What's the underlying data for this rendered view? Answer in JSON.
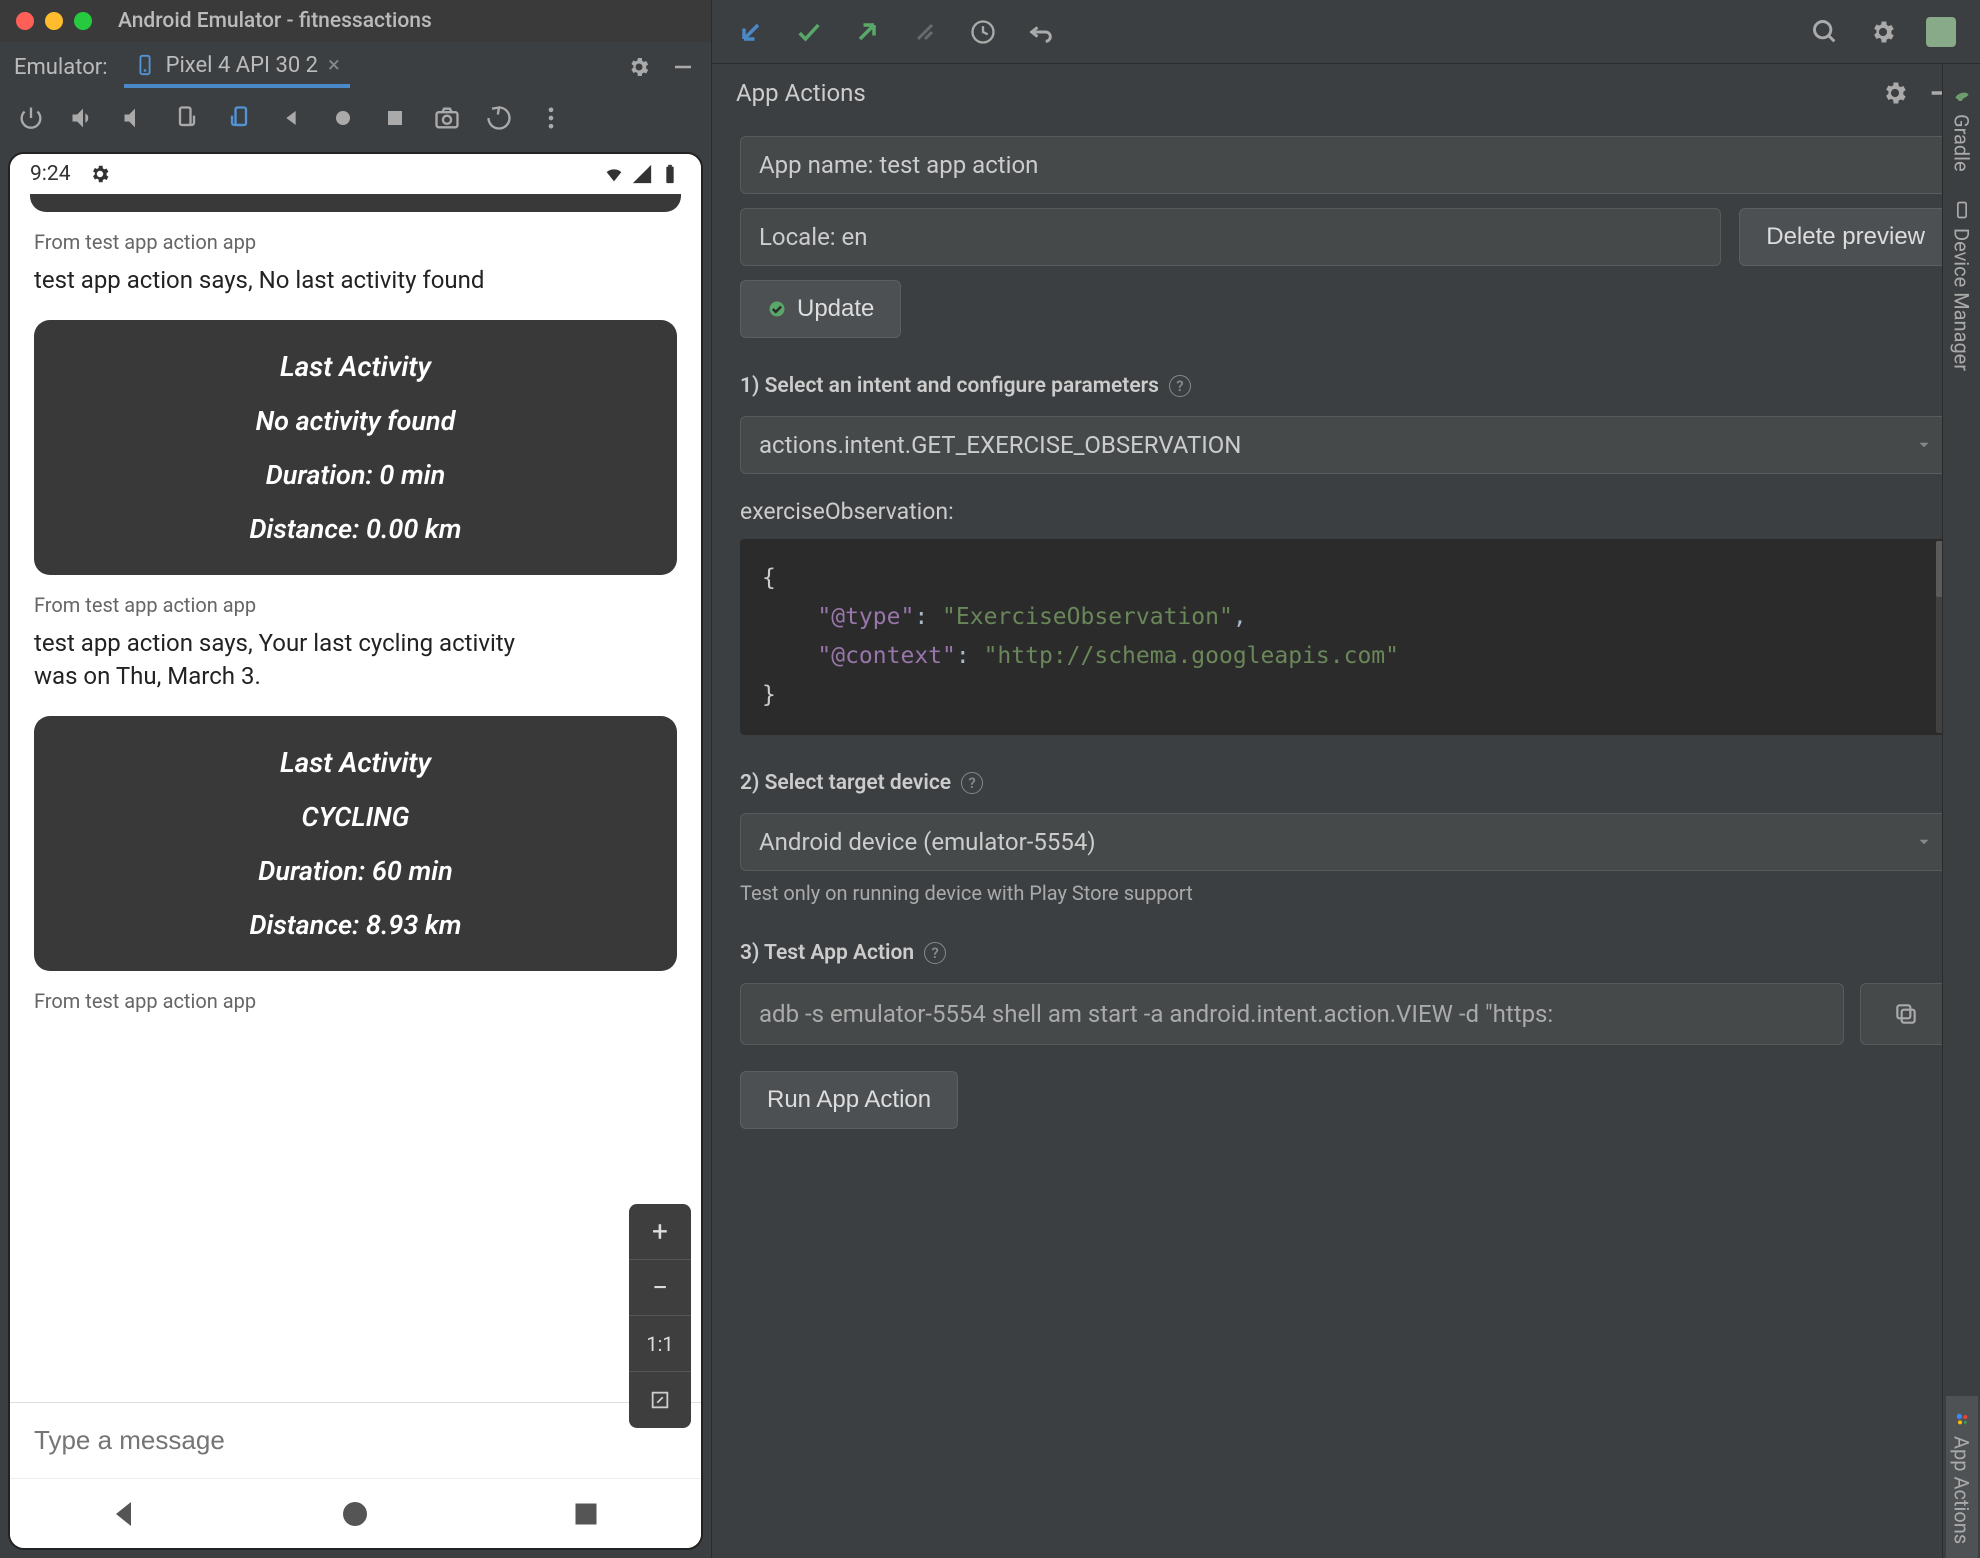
{
  "emulator": {
    "window_title": "Android Emulator - fitnessactions",
    "tab_label": "Emulator:",
    "device_name": "Pixel 4 API 30 2"
  },
  "android": {
    "status_time": "9:24",
    "messages": [
      {
        "from": "From test app action app",
        "text": "test app action says, No last activity found"
      },
      {
        "from": "From test app action app",
        "text": "test app action says, Your last cycling activity was on Thu, March 3."
      },
      {
        "from": "From test app action app",
        "text": ""
      }
    ],
    "cards": [
      {
        "title": "Last Activity",
        "activity": "No activity found",
        "duration": "Duration: 0 min",
        "distance": "Distance: 0.00 km"
      },
      {
        "title": "Last Activity",
        "activity": "CYCLING",
        "duration": "Duration: 60 min",
        "distance": "Distance: 8.93 km"
      }
    ],
    "input_placeholder": "Type a message",
    "zoom": {
      "plus": "+",
      "minus": "−",
      "fit": "1:1",
      "full": "⛶"
    }
  },
  "app_actions": {
    "panel_title": "App Actions",
    "app_name_field": "App name: test app action",
    "locale_field": "Locale: en",
    "delete_preview": "Delete preview",
    "update": "Update",
    "section1": "1) Select an intent and configure parameters",
    "intent_selected": "actions.intent.GET_EXERCISE_OBSERVATION",
    "param_label": "exerciseObservation:",
    "code": "{\n    \"@type\": \"ExerciseObservation\",\n    \"@context\": \"http://schema.googleapis.com\"\n}",
    "section2": "2) Select target device",
    "device_selected": "Android device (emulator-5554)",
    "device_hint": "Test only on running device with Play Store support",
    "section3": "3) Test App Action",
    "adb_cmd": "adb -s emulator-5554 shell am start -a android.intent.action.VIEW -d \"https:",
    "run_button": "Run App Action"
  },
  "rail": {
    "gradle": "Gradle",
    "device_manager": "Device Manager",
    "app_actions": "App Actions"
  }
}
